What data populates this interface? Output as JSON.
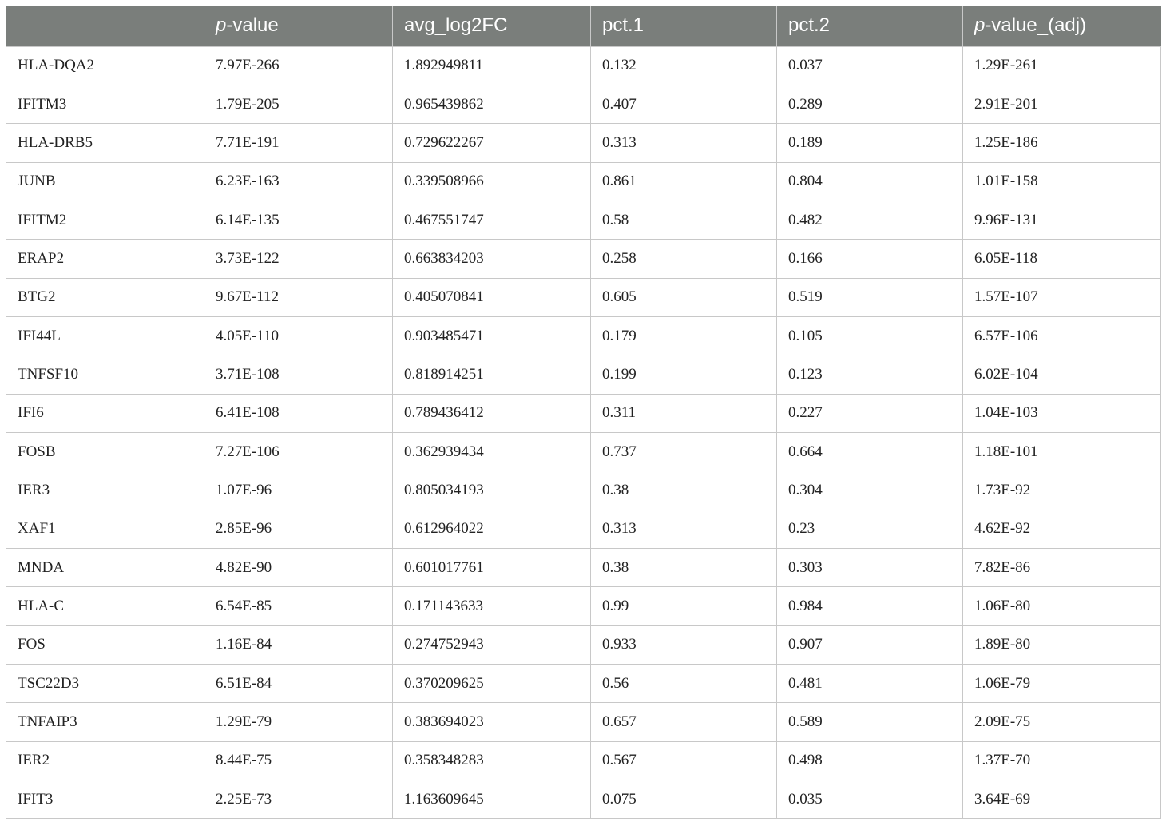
{
  "table": {
    "headers": [
      {
        "italic": "",
        "text": ""
      },
      {
        "italic": "p",
        "text": "-value"
      },
      {
        "italic": "",
        "text": "avg_log2FC"
      },
      {
        "italic": "",
        "text": "pct.1"
      },
      {
        "italic": "",
        "text": "pct.2"
      },
      {
        "italic": "p",
        "text": "-value_(adj)"
      }
    ],
    "rows": [
      [
        "HLA-DQA2",
        "7.97E-266",
        "1.892949811",
        "0.132",
        "0.037",
        "1.29E-261"
      ],
      [
        "IFITM3",
        "1.79E-205",
        "0.965439862",
        "0.407",
        "0.289",
        "2.91E-201"
      ],
      [
        "HLA-DRB5",
        "7.71E-191",
        "0.729622267",
        "0.313",
        "0.189",
        "1.25E-186"
      ],
      [
        "JUNB",
        "6.23E-163",
        "0.339508966",
        "0.861",
        "0.804",
        "1.01E-158"
      ],
      [
        "IFITM2",
        "6.14E-135",
        "0.467551747",
        "0.58",
        "0.482",
        "9.96E-131"
      ],
      [
        "ERAP2",
        "3.73E-122",
        "0.663834203",
        "0.258",
        "0.166",
        "6.05E-118"
      ],
      [
        "BTG2",
        "9.67E-112",
        "0.405070841",
        "0.605",
        "0.519",
        "1.57E-107"
      ],
      [
        "IFI44L",
        "4.05E-110",
        "0.903485471",
        "0.179",
        "0.105",
        "6.57E-106"
      ],
      [
        "TNFSF10",
        "3.71E-108",
        "0.818914251",
        "0.199",
        "0.123",
        "6.02E-104"
      ],
      [
        "IFI6",
        "6.41E-108",
        "0.789436412",
        "0.311",
        "0.227",
        "1.04E-103"
      ],
      [
        "FOSB",
        "7.27E-106",
        "0.362939434",
        "0.737",
        "0.664",
        "1.18E-101"
      ],
      [
        "IER3",
        "1.07E-96",
        "0.805034193",
        "0.38",
        "0.304",
        "1.73E-92"
      ],
      [
        "XAF1",
        "2.85E-96",
        "0.612964022",
        "0.313",
        "0.23",
        "4.62E-92"
      ],
      [
        "MNDA",
        "4.82E-90",
        "0.601017761",
        "0.38",
        "0.303",
        "7.82E-86"
      ],
      [
        "HLA-C",
        "6.54E-85",
        "0.171143633",
        "0.99",
        "0.984",
        "1.06E-80"
      ],
      [
        "FOS",
        "1.16E-84",
        "0.274752943",
        "0.933",
        "0.907",
        "1.89E-80"
      ],
      [
        "TSC22D3",
        "6.51E-84",
        "0.370209625",
        "0.56",
        "0.481",
        "1.06E-79"
      ],
      [
        "TNFAIP3",
        "1.29E-79",
        "0.383694023",
        "0.657",
        "0.589",
        "2.09E-75"
      ],
      [
        "IER2",
        "8.44E-75",
        "0.358348283",
        "0.567",
        "0.498",
        "1.37E-70"
      ],
      [
        "IFIT3",
        "2.25E-73",
        "1.163609645",
        "0.075",
        "0.035",
        "3.64E-69"
      ]
    ]
  }
}
